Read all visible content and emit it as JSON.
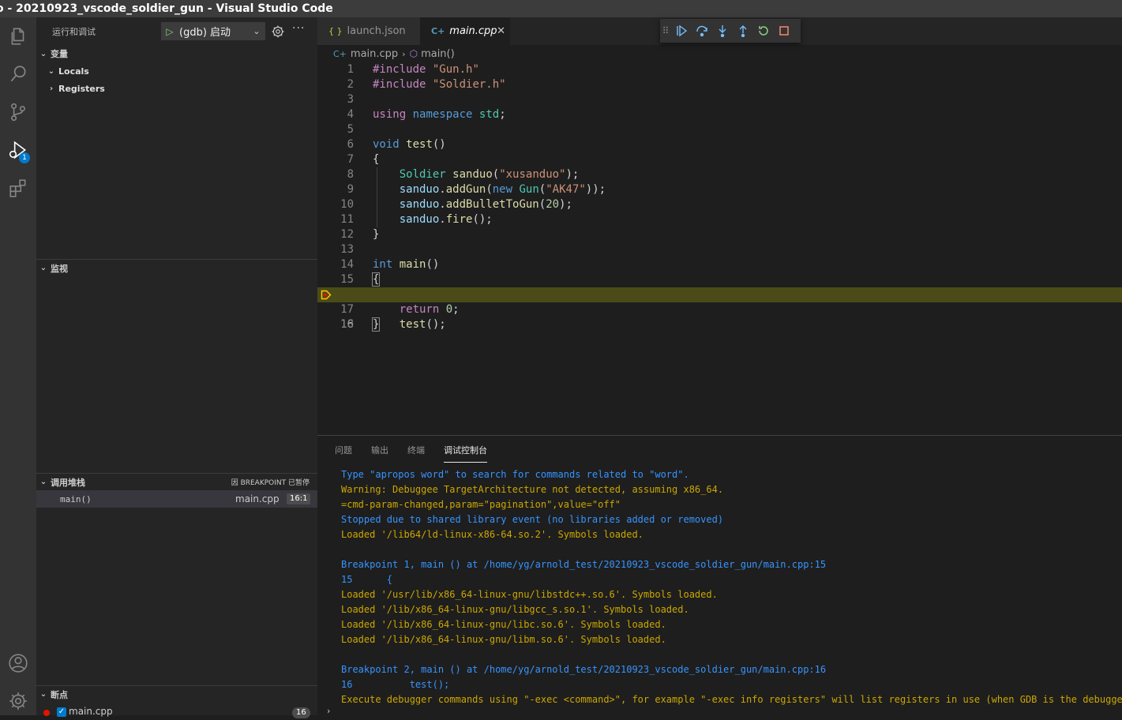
{
  "window": {
    "title": "o - 20210923_vscode_soldier_gun - Visual Studio Code"
  },
  "activity_bar": {
    "items": [
      "explorer-icon",
      "search-icon",
      "source-control-icon",
      "run-debug-icon",
      "extensions-icon"
    ],
    "debug_badge": "1",
    "bottom": [
      "account-icon",
      "settings-gear-icon"
    ],
    "active_color": "#ffffff"
  },
  "sidebar": {
    "title": "运行和调试",
    "launch_config": "(gdb) 启动",
    "more": "···",
    "variables": {
      "title": "变量",
      "scopes": [
        {
          "label": "Locals",
          "expanded": true
        },
        {
          "label": "Registers",
          "expanded": false
        }
      ]
    },
    "watch": {
      "title": "监视"
    },
    "call_stack": {
      "title": "调用堆栈",
      "status": "因 BREAKPOINT 已暂停",
      "frames": [
        {
          "name": "main()",
          "file": "main.cpp",
          "position": "16:1"
        }
      ]
    },
    "breakpoints": {
      "title": "断点",
      "items": [
        {
          "file": "main.cpp",
          "line": "16",
          "enabled": true
        }
      ]
    }
  },
  "tabs": [
    {
      "label": "launch.json",
      "icon": "{ }",
      "active": false
    },
    {
      "label": "main.cpp",
      "icon": "C++",
      "active": true
    }
  ],
  "debug_toolbar": [
    "continue-icon",
    "step-over-icon",
    "step-into-icon",
    "step-out-icon",
    "restart-icon",
    "stop-icon"
  ],
  "breadcrumb": {
    "file": "main.cpp",
    "symbol": "main()"
  },
  "editor": {
    "current_line": 16,
    "lines": [
      "#include \"Gun.h\"",
      "#include \"Soldier.h\"",
      "",
      "using namespace std;",
      "",
      "void test()",
      "{",
      "    Soldier sanduo(\"xusanduo\");",
      "    sanduo.addGun(new Gun(\"AK47\"));",
      "    sanduo.addBulletToGun(20);",
      "    sanduo.fire();",
      "}",
      "",
      "int main()",
      "{",
      "    test();",
      "    return 0;",
      "}"
    ]
  },
  "panel": {
    "tabs": [
      "问题",
      "输出",
      "终端",
      "调试控制台"
    ],
    "active_tab": "调试控制台",
    "console": [
      {
        "text": "Type \"apropos word\" to search for commands related to \"word\".",
        "color": "blue"
      },
      {
        "text": "Warning: Debuggee TargetArchitecture not detected, assuming x86_64.",
        "color": "yellow"
      },
      {
        "text": "=cmd-param-changed,param=\"pagination\",value=\"off\"",
        "color": "yellow"
      },
      {
        "text": "Stopped due to shared library event (no libraries added or removed)",
        "color": "blue"
      },
      {
        "text": "Loaded '/lib64/ld-linux-x86-64.so.2'. Symbols loaded.",
        "color": "yellow"
      },
      {
        "text": "",
        "color": "blue"
      },
      {
        "text": "Breakpoint 1, main () at /home/yg/arnold_test/20210923_vscode_soldier_gun/main.cpp:15",
        "color": "blue"
      },
      {
        "text": "15\t{",
        "color": "blue"
      },
      {
        "text": "Loaded '/usr/lib/x86_64-linux-gnu/libstdc++.so.6'. Symbols loaded.",
        "color": "yellow"
      },
      {
        "text": "Loaded '/lib/x86_64-linux-gnu/libgcc_s.so.1'. Symbols loaded.",
        "color": "yellow"
      },
      {
        "text": "Loaded '/lib/x86_64-linux-gnu/libc.so.6'. Symbols loaded.",
        "color": "yellow"
      },
      {
        "text": "Loaded '/lib/x86_64-linux-gnu/libm.so.6'. Symbols loaded.",
        "color": "yellow"
      },
      {
        "text": "",
        "color": "blue"
      },
      {
        "text": "Breakpoint 2, main () at /home/yg/arnold_test/20210923_vscode_soldier_gun/main.cpp:16",
        "color": "blue"
      },
      {
        "text": "16\t    test();",
        "color": "blue"
      },
      {
        "text": "Execute debugger commands using \"-exec <command>\", for example \"-exec info registers\" will list registers in use (when GDB is the debugger)",
        "color": "yellow"
      }
    ],
    "input_prompt": "›"
  }
}
